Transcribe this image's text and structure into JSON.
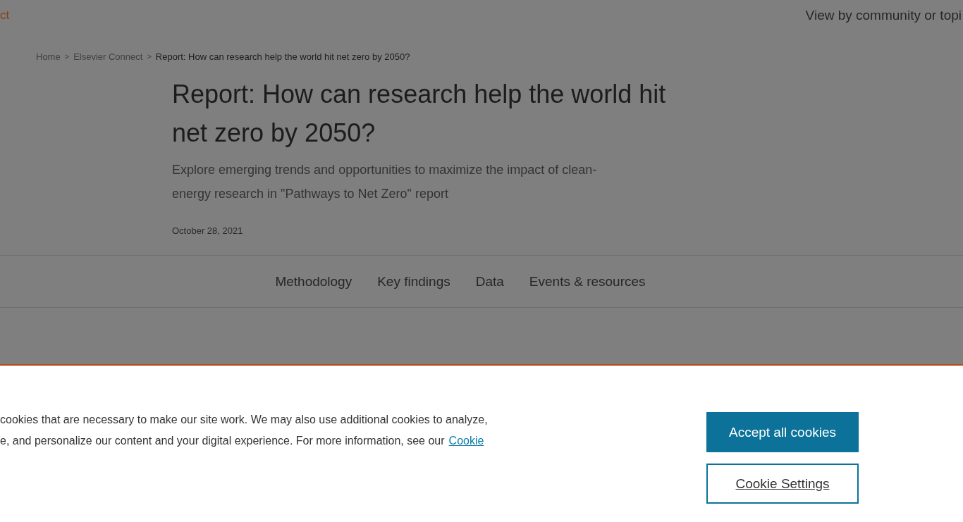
{
  "header": {
    "site_link": "ct",
    "community_link": "View by community or topi"
  },
  "breadcrumb": {
    "items": [
      {
        "label": "Home"
      },
      {
        "label": "Elsevier Connect"
      }
    ],
    "separator": ">",
    "current": "Report: How can research help the world hit net zero by 2050?"
  },
  "article": {
    "title": "Report: How can research help the world hit net zero by 2050?",
    "subtitle": "Explore emerging trends and opportunities to maximize the impact of clean-energy research in \"Pathways to Net Zero\" report",
    "date": "October 28, 2021"
  },
  "section_nav": [
    {
      "label": "Methodology"
    },
    {
      "label": "Key findings"
    },
    {
      "label": "Data"
    },
    {
      "label": "Events & resources"
    }
  ],
  "cookie_banner": {
    "lines": [
      "cookies that are necessary to make our site work. We may also use additional cookies to analyze,",
      "e, and personalize our content and your digital experience. For more information, see our"
    ],
    "link": "Cookie",
    "buttons": [
      {
        "kind": "primary",
        "label": "Accept all cookies"
      },
      {
        "kind": "outline",
        "label": "Cookie Settings"
      }
    ]
  }
}
